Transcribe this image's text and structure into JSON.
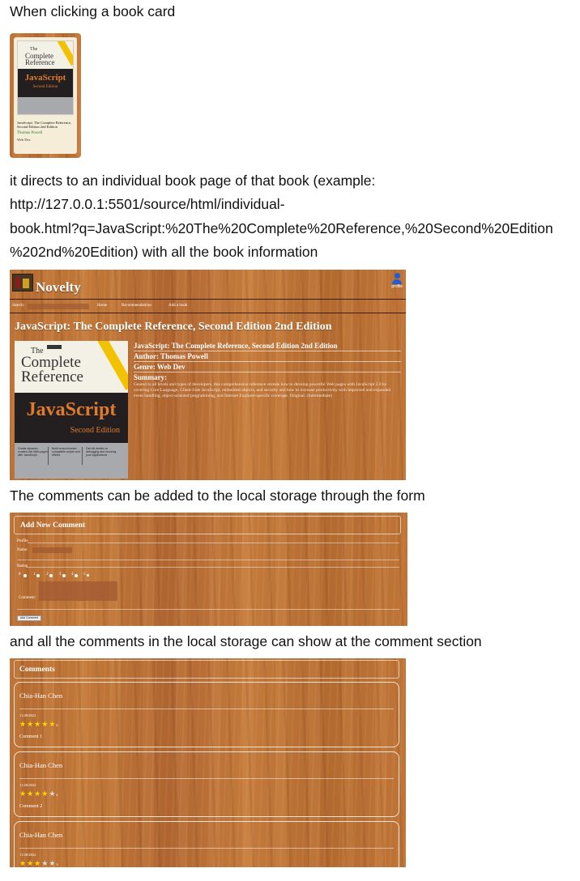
{
  "doc": {
    "para1": "When clicking a book card",
    "para2_lines": [
      "it directs to an individual book page of that book (example:",
      "http://127.0.0.1:5501/source/html/individual-",
      "book.html?q=JavaScript:%20The%20Complete%20Reference,%20Second%20Edition",
      "%202nd%20Edition) with all the book information"
    ],
    "para3": "The comments can be added to the local storage through the form",
    "para4": "and all the comments in the local storage can show at the comment section"
  },
  "book_card": {
    "cover_the": "The",
    "cover_complete": "Complete",
    "cover_reference": "Reference",
    "cover_js": "JavaScript",
    "cover_edition": "Second Edition",
    "title": "JavaScript: The Complete Reference, Second Edition 2nd Edition",
    "author": "Thomas Powell",
    "genre": "Web Dev"
  },
  "book_page": {
    "site_name": "Novelty",
    "profile_label": "profile",
    "search_label": "Search:",
    "nav": [
      "Home",
      "Recommendations",
      "Add a book"
    ],
    "page_title": "JavaScript: The Complete Reference, Second Edition 2nd Edition",
    "cover_the": "The",
    "cover_complete": "Complete",
    "cover_reference": "Reference",
    "cover_js": "JavaScript",
    "cover_edition": "Second Edition",
    "cover_features": [
      "Create dynamic, content-rich Web pages with JavaScript",
      "Build cross-browser compatible scripts and effects",
      "Get full details on debugging and securing your applications"
    ],
    "info_title": "JavaScript: The Complete Reference, Second Edition 2nd Edition",
    "info_author": "Author: Thomas Powell",
    "info_genre": "Genre: Web Dev",
    "info_summary_label": "Summary:",
    "info_summary": "Geared to all levels and types of developers, this comprehensive reference reveals how to develop powerful Web pages with JavaScript 2.0 by covering Core Language, Client-Side JavaScript, embedded objects, and security and how to increase productivity with improved and expanded event handling, object-oriented programming, and Internet Explorer-specific coverage. Original. (Intermediate)"
  },
  "comment_form": {
    "title": "Add New Comment",
    "profile_legend": "Profile",
    "name_label": "Name:",
    "rating_legend": "Rating",
    "rating_options": [
      "0",
      "1",
      "2",
      "3",
      "4",
      "5"
    ],
    "comment_label": "Comment:",
    "submit_label": "Add Comment"
  },
  "comments": {
    "header": "Comments",
    "items": [
      {
        "author": "Chia-Han Chen",
        "date": "11/28/2022",
        "rating": 5,
        "text": "Comment 1"
      },
      {
        "author": "Chia-Han Chen",
        "date": "11/28/2022",
        "rating": 4,
        "text": "Comment 2"
      },
      {
        "author": "Chia-Han Chen",
        "date": "11/28/2022",
        "rating": 3,
        "text": ""
      }
    ]
  },
  "colors": {
    "wood": "#b96d32",
    "star_on": "#ffd700",
    "star_off": "#dcdcdc",
    "cover_orange": "#e07b2a",
    "author_green": "#2a7a2a",
    "profile_blue": "#1e5fd6"
  }
}
